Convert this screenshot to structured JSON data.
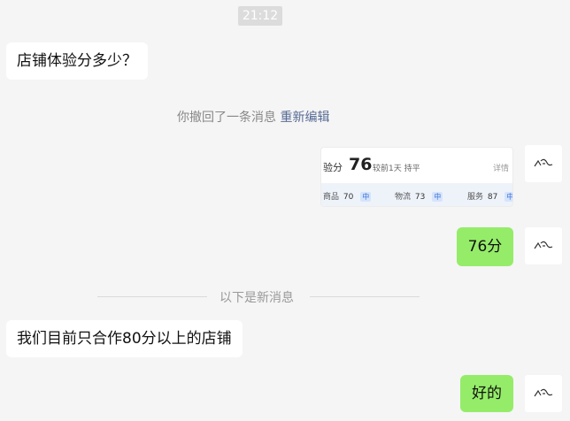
{
  "chat": {
    "timestamp": "21:12",
    "msg_in_1": "店铺体验分多少？",
    "recall_notice": {
      "text": "你撤回了一条消息",
      "action": "重新编辑"
    },
    "store_card": {
      "title": "验分",
      "score": "76",
      "subtitle": "较前1天 持平",
      "detail": "详情",
      "metrics": [
        {
          "label": "商品",
          "value": "70",
          "level": "中"
        },
        {
          "label": "物流",
          "value": "73",
          "level": "中"
        },
        {
          "label": "服务",
          "value": "87",
          "level": "中"
        }
      ]
    },
    "msg_out_1": "76分",
    "new_divider": "以下是新消息",
    "msg_in_2": "我们目前只合作80分以上的店铺",
    "msg_out_2": "好的"
  },
  "colors": {
    "background": "#f5f5f5",
    "outgoing_bubble": "#95ec69",
    "incoming_bubble": "#ffffff",
    "link": "#576b95"
  },
  "icons": {
    "avatar": "doodle-avatar-icon"
  }
}
